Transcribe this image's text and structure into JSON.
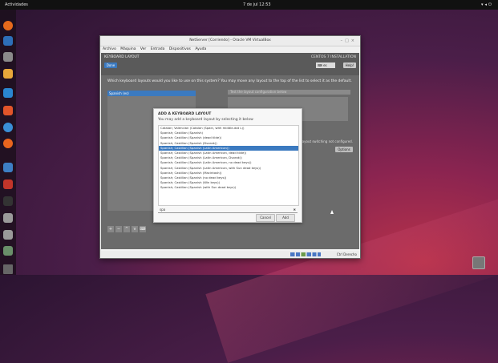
{
  "topbar": {
    "activities": "Actividades",
    "clock": "7 de jul  12:53",
    "status_icons": [
      "network-icon",
      "volume-icon",
      "power-icon"
    ]
  },
  "dock": {
    "icons": [
      "firefox-icon",
      "thunderbird-icon",
      "files-icon",
      "rhythmbox-icon",
      "writer-icon",
      "software-icon",
      "help-icon",
      "ubuntu-icon",
      "virtualbox-icon",
      "libreoffice-impress-icon",
      "terminal-icon",
      "files-2-icon",
      "disk-icon",
      "usb-icon",
      "trash-small-icon",
      "apps-grid-icon"
    ]
  },
  "vbox": {
    "title": "NetServer [Corriendo] - Oracle VM VirtualBox",
    "menu": [
      "Archivo",
      "Máquina",
      "Ver",
      "Entrada",
      "Dispositivos",
      "Ayuda"
    ],
    "status_hostkey": "Ctrl Derecho"
  },
  "guest": {
    "header_title": "KEYBOARD LAYOUT",
    "done_label": "Done",
    "header_right": "CENTOS 7 INSTALLATION",
    "lang_value": "es",
    "help_label": "Help!",
    "question": "Which keyboard layouts would you like to use on this system? You may move any layout to the top of the list to select it as the default.",
    "left_selected": "Spanish (es)",
    "test_placeholder": "Test the layout configuration below",
    "layout_note": "Layout switching not configured.",
    "options_label": "Options",
    "toolbar": [
      "+",
      "−",
      "^",
      "v",
      "⌨"
    ]
  },
  "dialog": {
    "title": "ADD A KEYBOARD LAYOUT",
    "subtitle": "You may add a keyboard layout by selecting it below",
    "items": [
      "Catalan; Valencian (Catalan (Spain, with middle-dot L))",
      "Spanish; Castilian (Spanish)",
      "Spanish; Castilian (Spanish (dead tilde))",
      "Spanish; Castilian (Spanish (Dvorak))",
      "Spanish; Castilian (Spanish (Latin American))",
      "Spanish; Castilian (Spanish (Latin American, dead tilde))",
      "Spanish; Castilian (Spanish (Latin American, Dvorak))",
      "Spanish; Castilian (Spanish (Latin American, no dead keys))",
      "Spanish; Castilian (Spanish (Latin American, with Sun dead keys))",
      "Spanish; Castilian (Spanish (Macintosh))",
      "Spanish; Castilian (Spanish (no dead keys))",
      "Spanish; Castilian (Spanish (Win keys))",
      "Spanish; Castilian (Spanish (with Sun dead keys))"
    ],
    "selected_index": 4,
    "search_value": "spa",
    "cancel_label": "Cancel",
    "add_label": "Add"
  },
  "colors": {
    "accent": "#3b7ac0",
    "desktop_dark": "#2b1431",
    "desktop_red": "#b8324a"
  }
}
